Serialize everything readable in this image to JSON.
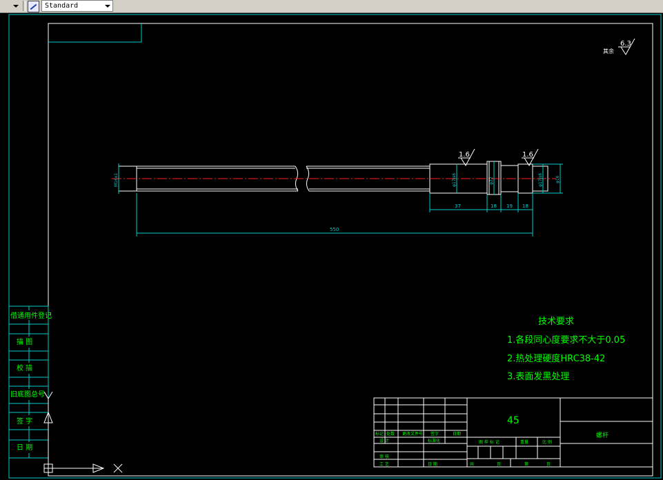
{
  "toolbar": {
    "text_style_value": "Standard"
  },
  "drawing": {
    "surface_roughness_other": "6.3",
    "surface_roughness_other_label": "其余",
    "roughness_values": [
      "1.6",
      "1.6"
    ],
    "diameter_labels": {
      "thread": "M16x1",
      "left_journal": "φ17js6",
      "collar": "φ22",
      "right_journal": "φ17js6",
      "end": "φ16"
    },
    "dimensions": {
      "overall_length": "550",
      "journal_length": "37",
      "collar_width": "18",
      "groove_width": "19",
      "end_width": "18"
    },
    "tech_requirements": {
      "title": "技术要求",
      "items": [
        "1.各段同心度要求不大于0.05",
        "2.热处理硬度HRC38-42",
        "3.表面发黑处理"
      ]
    },
    "side_panel": [
      "借通用件登记",
      "描  图",
      "校  描",
      "旧底图总号",
      "签  字",
      "日  期"
    ],
    "title_block": {
      "material": "45",
      "part_name": "螺杆",
      "rev_headers": [
        "标记",
        "处数",
        "更改文件号",
        "签字",
        "日期"
      ],
      "row_labels": [
        "设 计",
        "标准化"
      ],
      "approve_labels": [
        "审 核",
        "工 艺",
        "日 期"
      ],
      "stage_labels": [
        "图 样 标 记",
        "重量",
        "比 例"
      ],
      "sheet_labels": [
        "共",
        "页",
        "第",
        "页"
      ]
    }
  }
}
